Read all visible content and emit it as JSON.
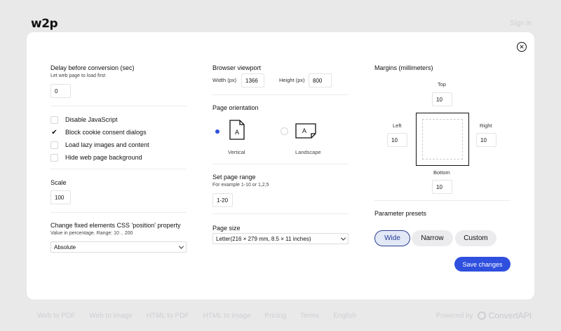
{
  "header": {
    "logo": "w2p",
    "signin": "Sign in"
  },
  "footer": {
    "links": [
      "Web to PDF",
      "Web to image",
      "HTML to PDF",
      "HTML to image",
      "Pricing",
      "Terms",
      "English"
    ],
    "powered_by": "Powered by",
    "brand": "ConvertAPI"
  },
  "modal": {
    "close_icon": "close-circle-icon",
    "delay": {
      "label": "Delay before conversion (sec)",
      "hint": "Let web page to load first",
      "value": "0"
    },
    "options": [
      {
        "label": "Disable JavaScript",
        "checked": false
      },
      {
        "label": "Block cookie consent dialogs",
        "checked": true
      },
      {
        "label": "Load lazy images and content",
        "checked": false
      },
      {
        "label": "Hide web page background",
        "checked": false
      }
    ],
    "checkmark": "✔",
    "scale": {
      "label": "Scale",
      "value": "100"
    },
    "fixed": {
      "label": "Change fixed elements CSS 'position' property",
      "hint": "Value in percentage. Range: 10 .. 200",
      "value": "Absolute"
    },
    "viewport": {
      "label": "Browser viewport",
      "width_label": "Width (px)",
      "width_value": "1366",
      "height_label": "Height (px)",
      "height_value": "800"
    },
    "orientation": {
      "label": "Page orientation",
      "vertical": "Vertical",
      "landscape": "Landscape",
      "selected": "Vertical",
      "page_letter": "A"
    },
    "range": {
      "label": "Set page range",
      "hint": "For example 1-10 or 1,2,5",
      "value": "1-20"
    },
    "page_size": {
      "label": "Page size",
      "value": "Letter(216 × 279 mm, 8.5 × 11 inches)"
    },
    "margins": {
      "label": "Margins (millimeters)",
      "top_label": "Top",
      "top": "10",
      "left_label": "Left",
      "left": "10",
      "right_label": "Right",
      "right": "10",
      "bottom_label": "Bottom",
      "bottom": "10"
    },
    "presets": {
      "label": "Parameter presets",
      "wide": "Wide",
      "narrow": "Narrow",
      "custom": "Custom",
      "active": "Wide"
    },
    "save_label": "Save changes"
  },
  "colors": {
    "accent": "#2f4fde",
    "active_border": "#2c3f8f"
  }
}
